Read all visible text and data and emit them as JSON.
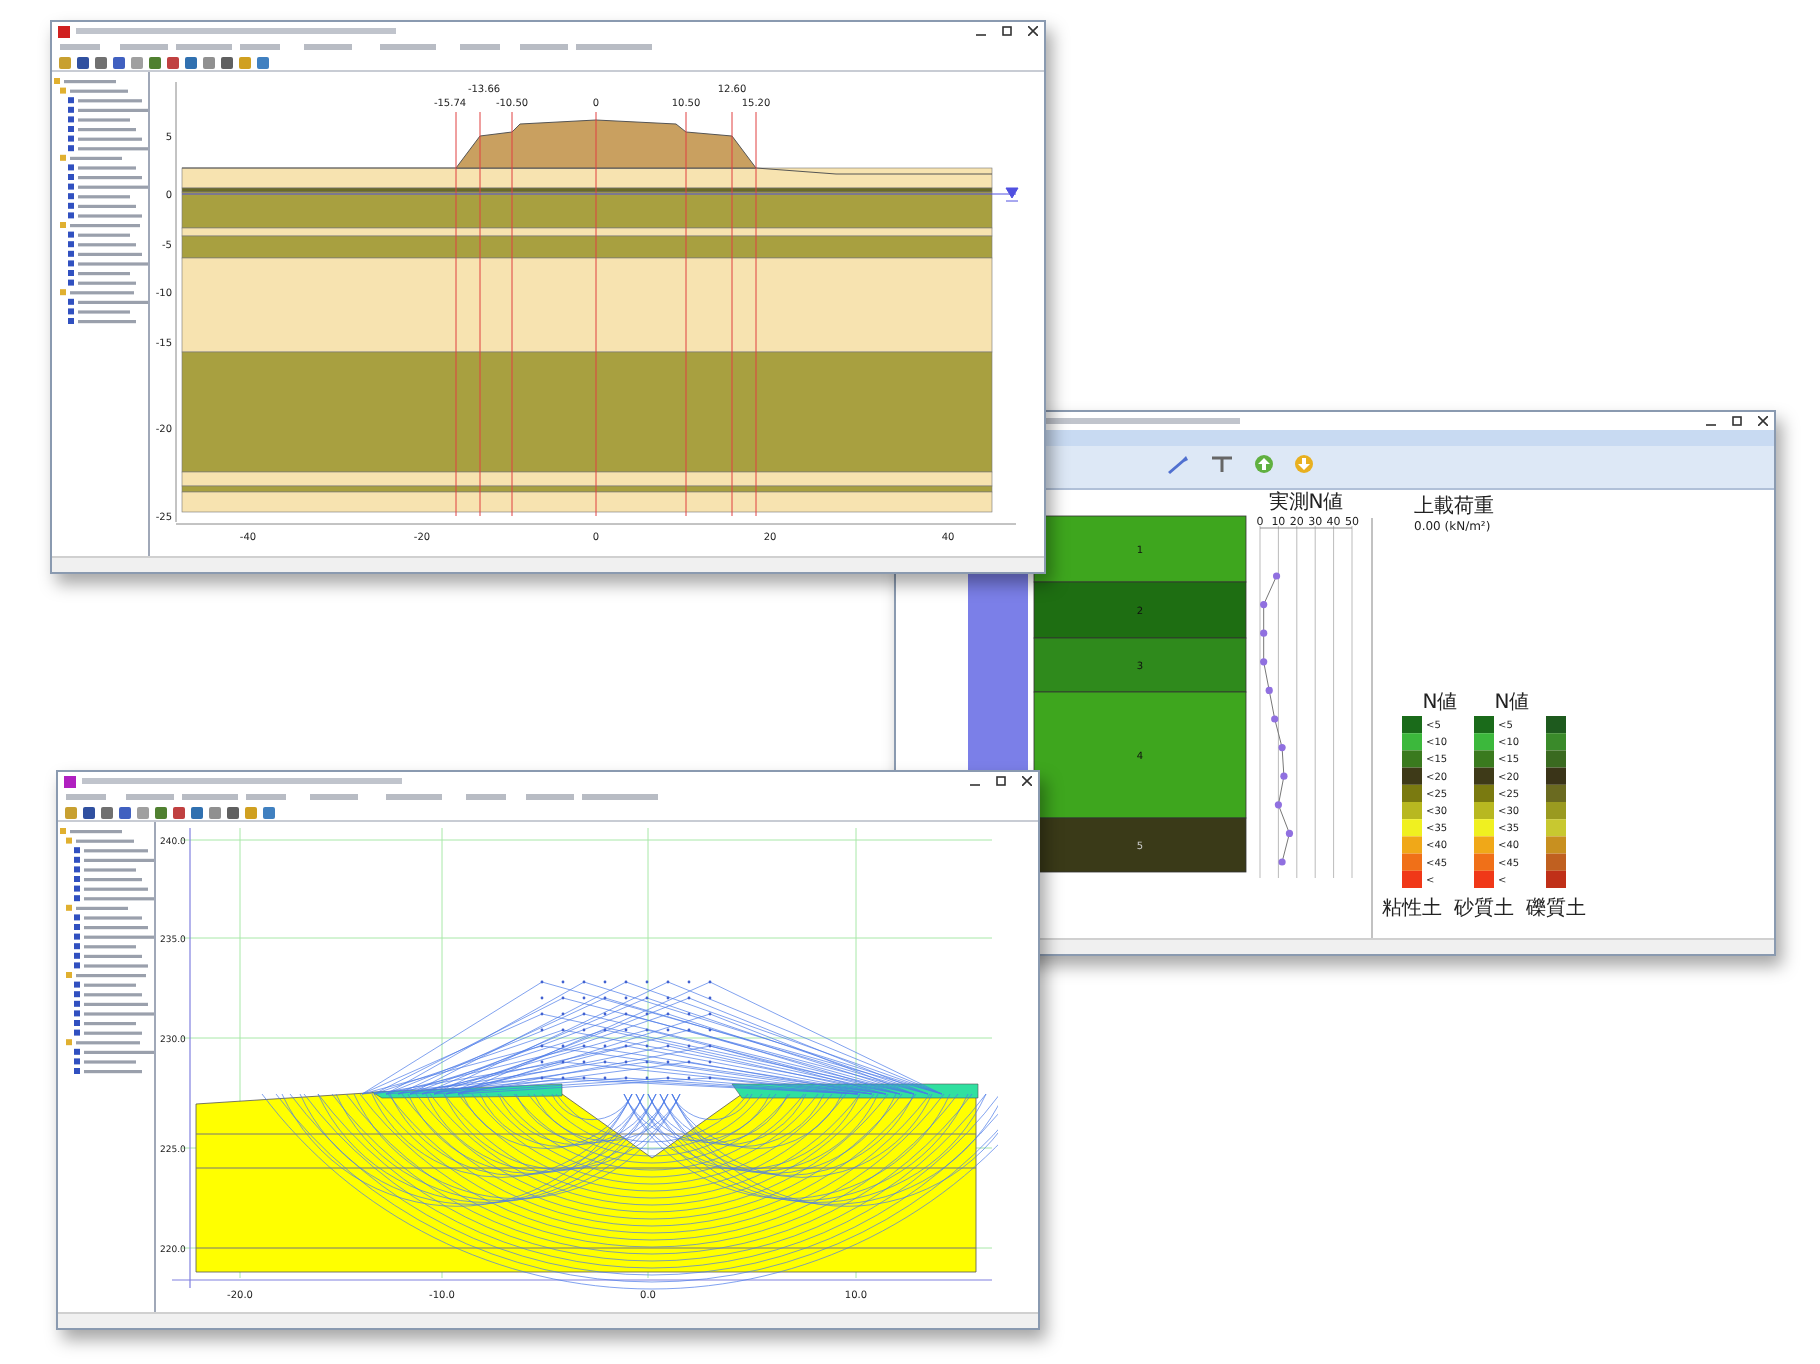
{
  "section_window": {
    "dimension_labels": [
      "-15.74",
      "-13.66",
      "-10.50",
      "0",
      "10.50",
      "12.60",
      "15.20"
    ],
    "y_axis": [
      "5",
      "0",
      "-5",
      "-10",
      "-15",
      "-20",
      "-25"
    ],
    "x_axis": [
      "-40",
      "-20",
      "0",
      "20",
      "40"
    ]
  },
  "boring_window": {
    "layers": [
      {
        "label": "1",
        "color": "#3ea61e"
      },
      {
        "label": "2",
        "color": "#1e6e12"
      },
      {
        "label": "3",
        "color": "#2f8a1c"
      },
      {
        "label": "4",
        "color": "#3ea61e"
      },
      {
        "label": "5",
        "color": "#3a3a18"
      }
    ],
    "n_chart": {
      "chart_data": {
        "type": "line",
        "title": "実測N値",
        "orientation": "horizontal",
        "xlim": [
          0,
          50
        ],
        "xticks": [
          0,
          10,
          20,
          30,
          40,
          50
        ],
        "grid": true,
        "marker": true,
        "values": [
          9,
          2,
          2,
          2,
          5,
          8,
          12,
          13,
          10,
          16,
          12
        ]
      }
    },
    "load_title": "上載荷重",
    "load_value": "0.00 (kN/m²)",
    "legend": {
      "scales": [
        {
          "header": "N値",
          "labels": [
            "<5",
            "<10",
            "<15",
            "<20",
            "<25",
            "<30",
            "<35",
            "<40",
            "<45",
            "<"
          ]
        },
        {
          "header": "N値",
          "labels": [
            "<5",
            "<10",
            "<15",
            "<20",
            "<25",
            "<30",
            "<35",
            "<40",
            "<45",
            "<"
          ]
        }
      ],
      "columns": [
        {
          "name": "粘性土",
          "swatches": [
            {
              "color": "#1a6b1a"
            },
            {
              "color": "#3cb83c"
            },
            {
              "color": "#3a7a1e"
            },
            {
              "color": "#3e3a18"
            },
            {
              "color": "#7a7a10"
            },
            {
              "color": "#b8b820"
            },
            {
              "color": "#f0f020"
            },
            {
              "color": "#f0a818"
            },
            {
              "color": "#f07018"
            },
            {
              "color": "#f03818"
            }
          ]
        },
        {
          "name": "砂質土",
          "swatches": [
            {
              "color": "#1a6b1a"
            },
            {
              "color": "#3cb83c"
            },
            {
              "color": "#3a7a1e"
            },
            {
              "color": "#3e3a18"
            },
            {
              "color": "#7a7a10"
            },
            {
              "color": "#b8b820"
            },
            {
              "color": "#f0f020"
            },
            {
              "color": "#f0a818"
            },
            {
              "color": "#f07018"
            },
            {
              "color": "#f03818"
            }
          ]
        },
        {
          "name": "礫質土",
          "swatches": [
            {
              "color": "#1e5a1e"
            },
            {
              "color": "#3a8a2a"
            },
            {
              "color": "#3a6a20"
            },
            {
              "color": "#3a3418"
            },
            {
              "color": "#6a6a20"
            },
            {
              "color": "#9a9a20"
            },
            {
              "color": "#c8c830"
            },
            {
              "color": "#c89020"
            },
            {
              "color": "#c06020"
            },
            {
              "color": "#c03018"
            }
          ]
        }
      ]
    }
  },
  "slip_window": {
    "y_axis": [
      "240.0",
      "235.0",
      "230.0",
      "225.0",
      "220.0"
    ],
    "x_axis": [
      "-20.0",
      "-10.0",
      "0.0",
      "10.0"
    ]
  }
}
